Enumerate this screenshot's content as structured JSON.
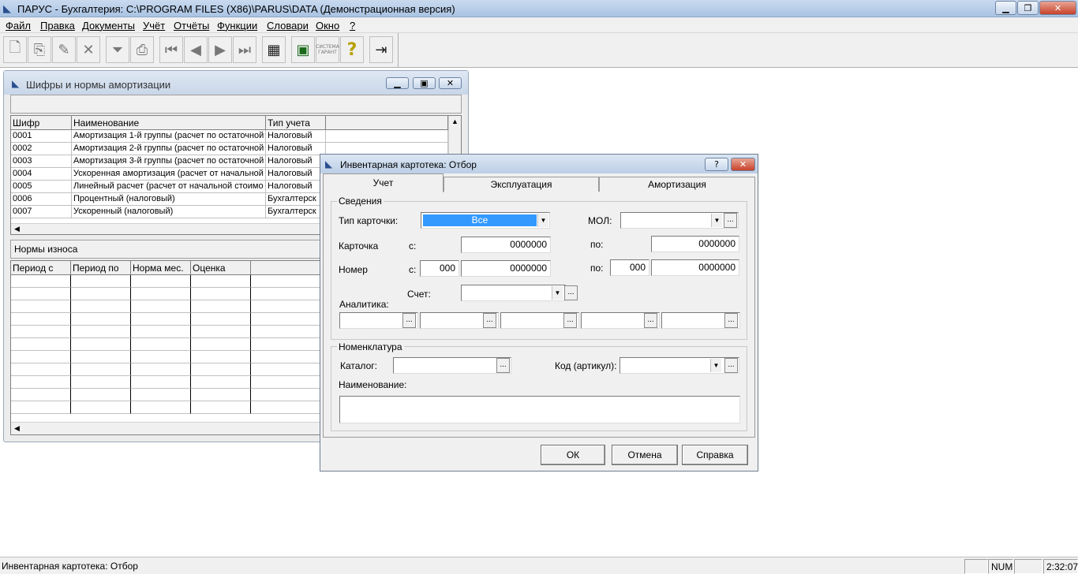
{
  "app": {
    "title": "ПАРУС - Бухгалтерия: C:\\PROGRAM FILES (X86)\\PARUS\\DATA (Демонстрационная версия)",
    "win_min": "▁",
    "win_restore": "❐",
    "win_close": "✕"
  },
  "menu": [
    "Файл",
    "Правка",
    "Документы",
    "Учёт",
    "Отчёты",
    "Функции",
    "Словари",
    "Окно",
    "?"
  ],
  "toolbar": {
    "icons": [
      "new-doc-icon",
      "copy-doc-icon",
      "edit-doc-icon",
      "delete-icon",
      "filter-icon",
      "print-icon",
      "first-record-icon",
      "prev-record-icon",
      "next-record-icon",
      "last-record-icon",
      "report-icon",
      "calculator-icon",
      "garant-icon",
      "help-icon",
      "exit-icon"
    ],
    "garant_text": "СИСТЕМА ГАРАНТ"
  },
  "amort_window": {
    "title": "Шифры и нормы амортизации",
    "columns": [
      "Шифр",
      "Наименование",
      "Тип учета"
    ],
    "rows": [
      [
        "0001",
        "Амортизация 1-й группы (расчет по остаточной",
        "Налоговый"
      ],
      [
        "0002",
        "Амортизация 2-й группы (расчет по остаточной",
        "Налоговый"
      ],
      [
        "0003",
        "Амортизация 3-й группы (расчет по остаточной",
        "Налоговый"
      ],
      [
        "0004",
        "Ускоренная амортизация (расчет от начальной",
        "Налоговый"
      ],
      [
        "0005",
        "Линейный расчет (расчет от начальной стоимо",
        "Налоговый"
      ],
      [
        "0006",
        "Процентный (налоговый)",
        "Бухгалтерск"
      ],
      [
        "0007",
        "Ускоренный (налоговый)",
        "Бухгалтерск"
      ]
    ],
    "norms_label": "Нормы износа",
    "norms_columns": [
      "Период с",
      "Период по",
      "Норма мес.",
      "Оценка"
    ]
  },
  "dialog": {
    "title": "Инвентарная картотека: Отбор",
    "help_btn": "?",
    "close_btn": "✕",
    "tabs": [
      "Учет",
      "Эксплуатация",
      "Амортизация"
    ],
    "group_info": "Сведения",
    "card_type_label": "Тип карточки:",
    "card_type_value": "Все",
    "mol_label": "МОЛ:",
    "card_label": "Карточка",
    "from_label": "с:",
    "to_label": "по:",
    "card_from": "0000000",
    "card_to": "0000000",
    "number_label": "Номер",
    "number_prefix_from": "000",
    "number_from": "0000000",
    "number_prefix_to": "000",
    "number_to": "0000000",
    "account_label": "Счет:",
    "analytics_label": "Аналитика:",
    "group_nomenclature": "Номенклатура",
    "catalog_label": "Каталог:",
    "code_label": "Код (артикул):",
    "name_label": "Наименование:",
    "ok": "ОК",
    "cancel": "Отмена",
    "help": "Справка"
  },
  "status": {
    "text": "Инвентарная картотека: Отбор",
    "num": "NUM",
    "time": "2:32:07"
  }
}
